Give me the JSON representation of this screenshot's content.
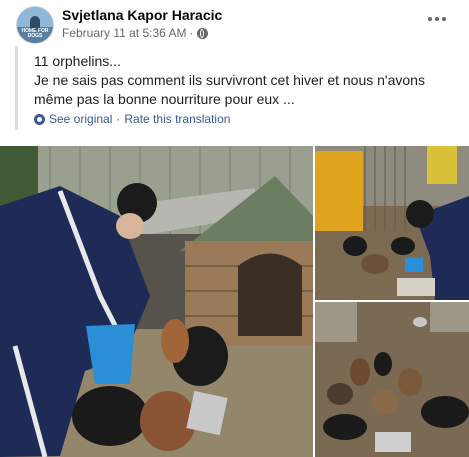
{
  "post": {
    "author": "Svjetlana Kapor Haracic",
    "timestamp": "February 11 at 5:36 AM",
    "meta_separator": "·",
    "avatar_text": "HOME FOR DOGS",
    "text_lines": [
      "11 orphelins...",
      "Je ne sais pas comment ils survivront cet hiver et nous n'avons",
      "même pas la bonne nourriture pour eux ..."
    ],
    "see_original": "See original",
    "rate_translation": "Rate this translation",
    "link_separator": "·"
  },
  "icons": {
    "privacy": "globe-icon",
    "more": "more-options-icon",
    "translation": "gear-icon"
  },
  "colors": {
    "link": "#385898",
    "secondary_text": "#65676b",
    "quote_bar": "#dadde1"
  }
}
